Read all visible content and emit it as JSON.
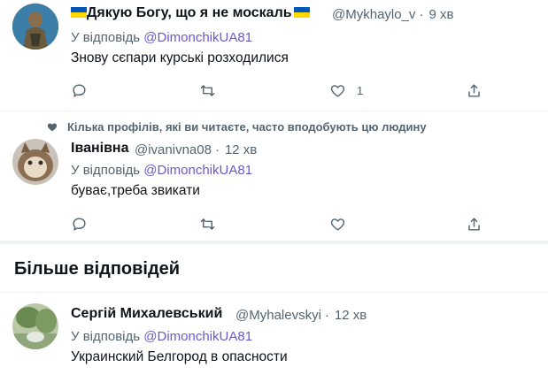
{
  "tweets": [
    {
      "display_name": "Дякую Богу, що я не москаль",
      "handle": "@Mykhaylo_v",
      "time": "9 хв",
      "reply_prefix": "У відповідь",
      "reply_mention": "@DimonchikUA81",
      "text": "Знову сєпари курські розходилися",
      "likes": "1",
      "retweets": "",
      "replies": ""
    },
    {
      "social_context": "Кілька профілів, які ви читаєте, часто вподобують цю людину",
      "display_name": "Іванівна",
      "handle": "@ivanivna08",
      "time": "12 хв",
      "reply_prefix": "У відповідь",
      "reply_mention": "@DimonchikUA81",
      "text": "буває,треба звикати",
      "likes": "",
      "retweets": "",
      "replies": ""
    },
    {
      "display_name": "Сергій Михалевський",
      "handle": "@Myhalevskyi",
      "time": "12 хв",
      "reply_prefix": "У відповідь",
      "reply_mention": "@DimonchikUA81",
      "text": "Украинский Белгород в опасности"
    }
  ],
  "section_title": "Більше відповідей",
  "colors": {
    "mention": "#6a5acd",
    "secondary": "#536471",
    "divider": "#eff3f4",
    "flag_blue": "#0057b7",
    "flag_yellow": "#ffd700"
  }
}
